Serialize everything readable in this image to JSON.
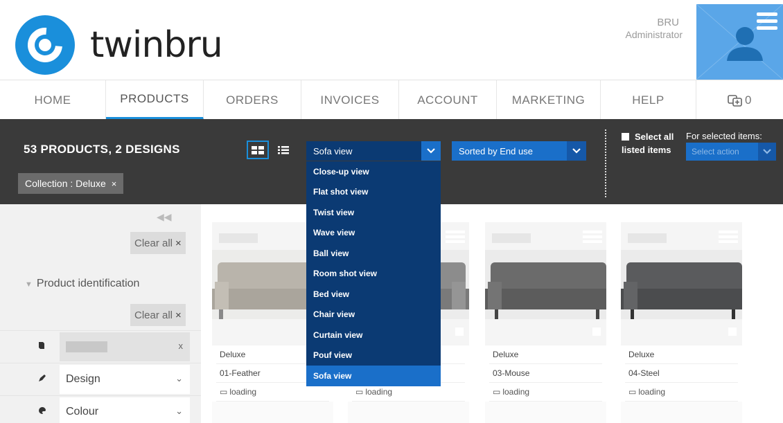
{
  "header": {
    "brand": "twinbru",
    "user_name": "BRU",
    "user_role": "Administrator"
  },
  "nav": {
    "items": [
      {
        "label": "HOME"
      },
      {
        "label": "PRODUCTS"
      },
      {
        "label": "ORDERS"
      },
      {
        "label": "INVOICES"
      },
      {
        "label": "ACCOUNT"
      },
      {
        "label": "MARKETING"
      },
      {
        "label": "HELP"
      }
    ],
    "active": "PRODUCTS",
    "cart_count": "0"
  },
  "toolbar": {
    "count_text": "53 PRODUCTS, 2 DESIGNS",
    "chip_label": "Collection : Deluxe",
    "chip_close": "×",
    "view_select": "Sofa view",
    "sort_select": "Sorted by End use",
    "select_all_label": "Select all listed items",
    "for_selected_label": "For selected items:",
    "select_action_placeholder": "Select action"
  },
  "view_options": [
    "Close-up view",
    "Flat shot view",
    "Twist view",
    "Wave view",
    "Ball view",
    "Room shot view",
    "Bed view",
    "Chair view",
    "Curtain view",
    "Pouf view",
    "Sofa view"
  ],
  "sidebar": {
    "collapse_symbol": "◀◀",
    "clear_all_label": "Clear all",
    "clear_all_x": "×",
    "section_title": "Product identification",
    "filters": [
      {
        "label": "",
        "icon": "book-icon",
        "right": "x"
      },
      {
        "label": "Design",
        "icon": "pen-icon",
        "right": "⌄"
      },
      {
        "label": "Colour",
        "icon": "palette-icon",
        "right": "⌄"
      }
    ]
  },
  "products": [
    {
      "collection": "Deluxe",
      "name": "01-Feather",
      "status": "loading",
      "color": "#b9b4ab"
    },
    {
      "collection": "",
      "name": "",
      "status": "loading",
      "color": "#8c8c8c"
    },
    {
      "collection": "Deluxe",
      "name": "03-Mouse",
      "status": "loading",
      "color": "#6b6b6b"
    },
    {
      "collection": "Deluxe",
      "name": "04-Steel",
      "status": "loading",
      "color": "#5a5b5d"
    }
  ],
  "colors": {
    "accent": "#1a8fdb",
    "dark_bar": "#3a3a3a",
    "dropdown_bg": "#0b3a73",
    "selected_bg": "#1a6fc9"
  }
}
